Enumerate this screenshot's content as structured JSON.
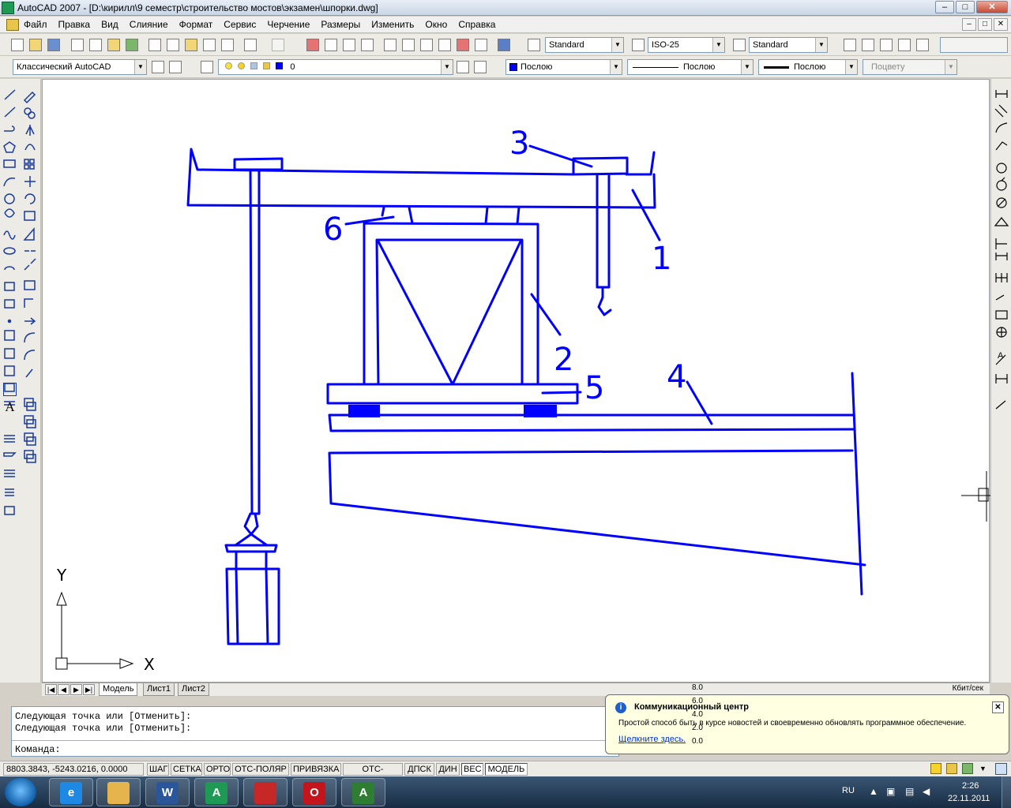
{
  "window": {
    "title": "AutoCAD 2007 - [D:\\кирилл\\9 семестр\\строительство мостов\\экзамен\\шпорки.dwg]",
    "controls": [
      "–",
      "□",
      "✕"
    ]
  },
  "menu": {
    "items": [
      "Файл",
      "Правка",
      "Вид",
      "Слияние",
      "Формат",
      "Сервис",
      "Черчение",
      "Размеры",
      "Изменить",
      "Окно",
      "Справка"
    ],
    "mdi_controls": [
      "–",
      "□",
      "✕"
    ]
  },
  "toolbar1": {
    "text_style": "Standard",
    "dim_style": "ISO-25",
    "table_style": "Standard"
  },
  "toolbar2": {
    "workspace": "Классический AutoCAD",
    "layer": "0",
    "color": "Послою",
    "linetype": "Послою",
    "lineweight": "Послою",
    "plot_style": "Поцвету"
  },
  "colors": {
    "drawing": "#0000ff",
    "canvas": "#ffffff",
    "crosshair": "#000000"
  },
  "drawing_labels": [
    "1",
    "2",
    "3",
    "4",
    "5",
    "6"
  ],
  "ucs": {
    "x_label": "X",
    "y_label": "Y"
  },
  "layout_tabs": {
    "nav": [
      "|◀",
      "◀",
      "▶",
      "▶|"
    ],
    "tabs": [
      "Модель",
      "Лист1",
      "Лист2"
    ],
    "rate_unit": "Кбит/сек"
  },
  "net_graph": {
    "ticks": [
      "8.0",
      "6.0",
      "4.0",
      "2.0",
      "0.0"
    ]
  },
  "command_line": {
    "history": [
      "Следующая точка или [Отменить]:",
      "Следующая точка или [Отменить]:"
    ],
    "prompt": "Команда:"
  },
  "status_bar": {
    "coordinates": "8803.3843, -5243.0216, 0.0000",
    "toggles": [
      {
        "label": "ШАГ",
        "on": false
      },
      {
        "label": "СЕТКА",
        "on": false
      },
      {
        "label": "ОРТО",
        "on": false
      },
      {
        "label": "ОТС-ПОЛЯР",
        "on": false
      },
      {
        "label": "ПРИВЯЗКА",
        "on": false
      },
      {
        "label": "ОТС-ОБЪЕКТ",
        "on": false
      },
      {
        "label": "ДПСК",
        "on": false
      },
      {
        "label": "ДИН",
        "on": false
      },
      {
        "label": "ВЕС",
        "on": true
      },
      {
        "label": "МОДЕЛЬ",
        "on": true
      }
    ]
  },
  "balloon": {
    "title": "Коммуникационный центр",
    "body": "Простой способ быть в курсе новостей и своевременно обновлять программное обеспечение.",
    "link": "Щелкните здесь.",
    "close": "✕"
  },
  "taskbar": {
    "apps": [
      {
        "name": "Internet Explorer",
        "glyph": "e",
        "color": "#1e88e5"
      },
      {
        "name": "Explorer",
        "glyph": "",
        "color": "#e6b44c"
      },
      {
        "name": "Word",
        "glyph": "W",
        "color": "#2b579a"
      },
      {
        "name": "AutoCAD",
        "glyph": "A",
        "color": "#1f9a54"
      },
      {
        "name": "Adobe Reader",
        "glyph": "",
        "color": "#c62828"
      },
      {
        "name": "Opera",
        "glyph": "O",
        "color": "#c4151c"
      },
      {
        "name": "App",
        "glyph": "A",
        "color": "#2e7d32"
      }
    ],
    "language": "RU",
    "time": "2:26",
    "date": "22.11.2011"
  }
}
